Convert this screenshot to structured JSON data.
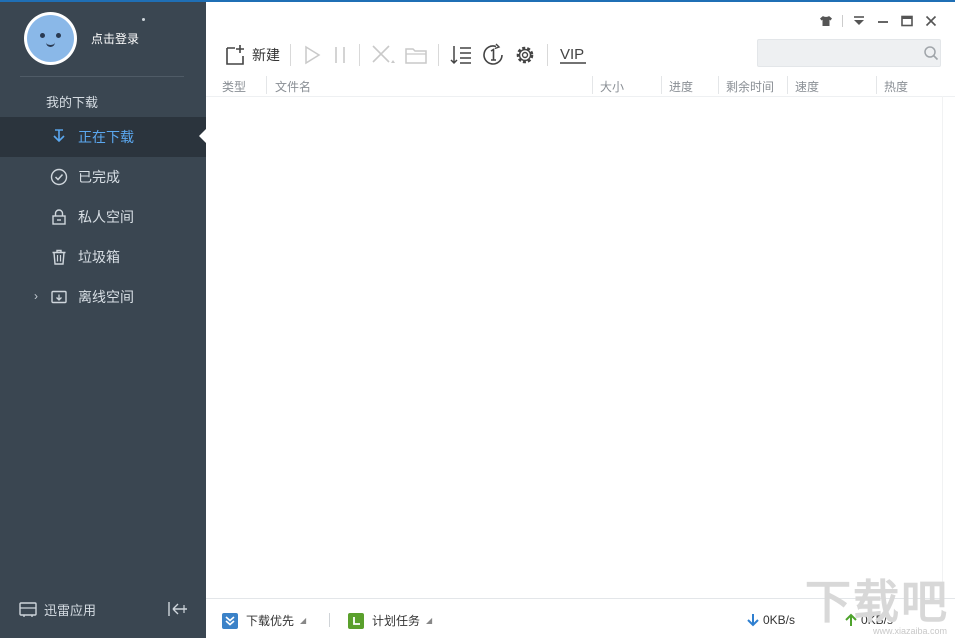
{
  "sidebar": {
    "login_label": "点击登录",
    "group_label": "我的下载",
    "items": [
      {
        "label": "正在下载",
        "icon": "download-arrow-icon",
        "active": true
      },
      {
        "label": "已完成",
        "icon": "check-circle-icon",
        "active": false
      },
      {
        "label": "私人空间",
        "icon": "lock-icon",
        "active": false
      },
      {
        "label": "垃圾箱",
        "icon": "trash-icon",
        "active": false
      },
      {
        "label": "离线空间",
        "icon": "cloud-folder-icon",
        "active": false
      }
    ],
    "apps_label": "迅雷应用"
  },
  "toolbar": {
    "new_label": "新建",
    "vip_label": "VIP"
  },
  "search": {
    "placeholder": ""
  },
  "table": {
    "columns": [
      "类型",
      "文件名",
      "大小",
      "进度",
      "剩余时间",
      "速度",
      "热度"
    ]
  },
  "statusbar": {
    "priority_label": "下载优先",
    "schedule_label": "计划任务",
    "down_speed": "0KB/s",
    "up_speed": "0KB/s"
  },
  "watermark": {
    "text": "下载吧",
    "url": "www.xiazaiba.com"
  },
  "colors": {
    "sidebar_bg": "#3a4651",
    "active_item_bg": "#2b343d",
    "accent_blue": "#5ba8f0",
    "priority_green": "#5aa02c",
    "priority_blue": "#3b82c8"
  }
}
